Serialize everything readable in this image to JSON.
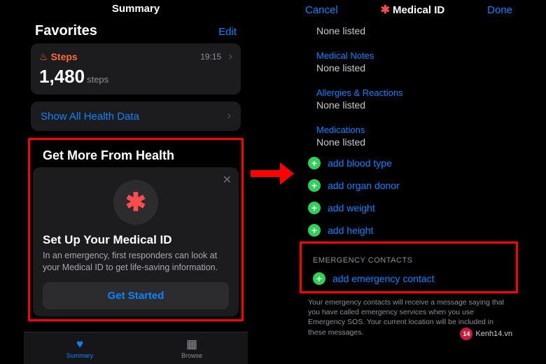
{
  "left": {
    "title": "Summary",
    "favorites_heading": "Favorites",
    "edit": "Edit",
    "steps": {
      "label": "Steps",
      "time": "19:15",
      "count": "1,480",
      "unit": "steps"
    },
    "show_all": "Show All Health Data",
    "more_health": "Get More From Health",
    "medical_card": {
      "title": "Set Up Your Medical ID",
      "desc": "In an emergency, first responders can look at your Medical ID to get life-saving information.",
      "button": "Get Started"
    },
    "tabs": {
      "summary": "Summary",
      "browse": "Browse"
    }
  },
  "right": {
    "cancel": "Cancel",
    "title": "Medical ID",
    "done": "Done",
    "none_top": "None listed",
    "sections": [
      {
        "label": "Medical Notes",
        "value": "None listed"
      },
      {
        "label": "Allergies & Reactions",
        "value": "None listed"
      },
      {
        "label": "Medications",
        "value": "None listed"
      }
    ],
    "adds": [
      "add blood type",
      "add organ donor",
      "add weight",
      "add height"
    ],
    "emergency_header": "EMERGENCY CONTACTS",
    "emergency_add": "add emergency contact",
    "footnote": "Your emergency contacts will receive a message saying that you have called emergency services when you use Emergency SOS. Your current location will be included in these messages."
  },
  "watermark": {
    "badge": "14",
    "text": "Kenh14.vn"
  }
}
